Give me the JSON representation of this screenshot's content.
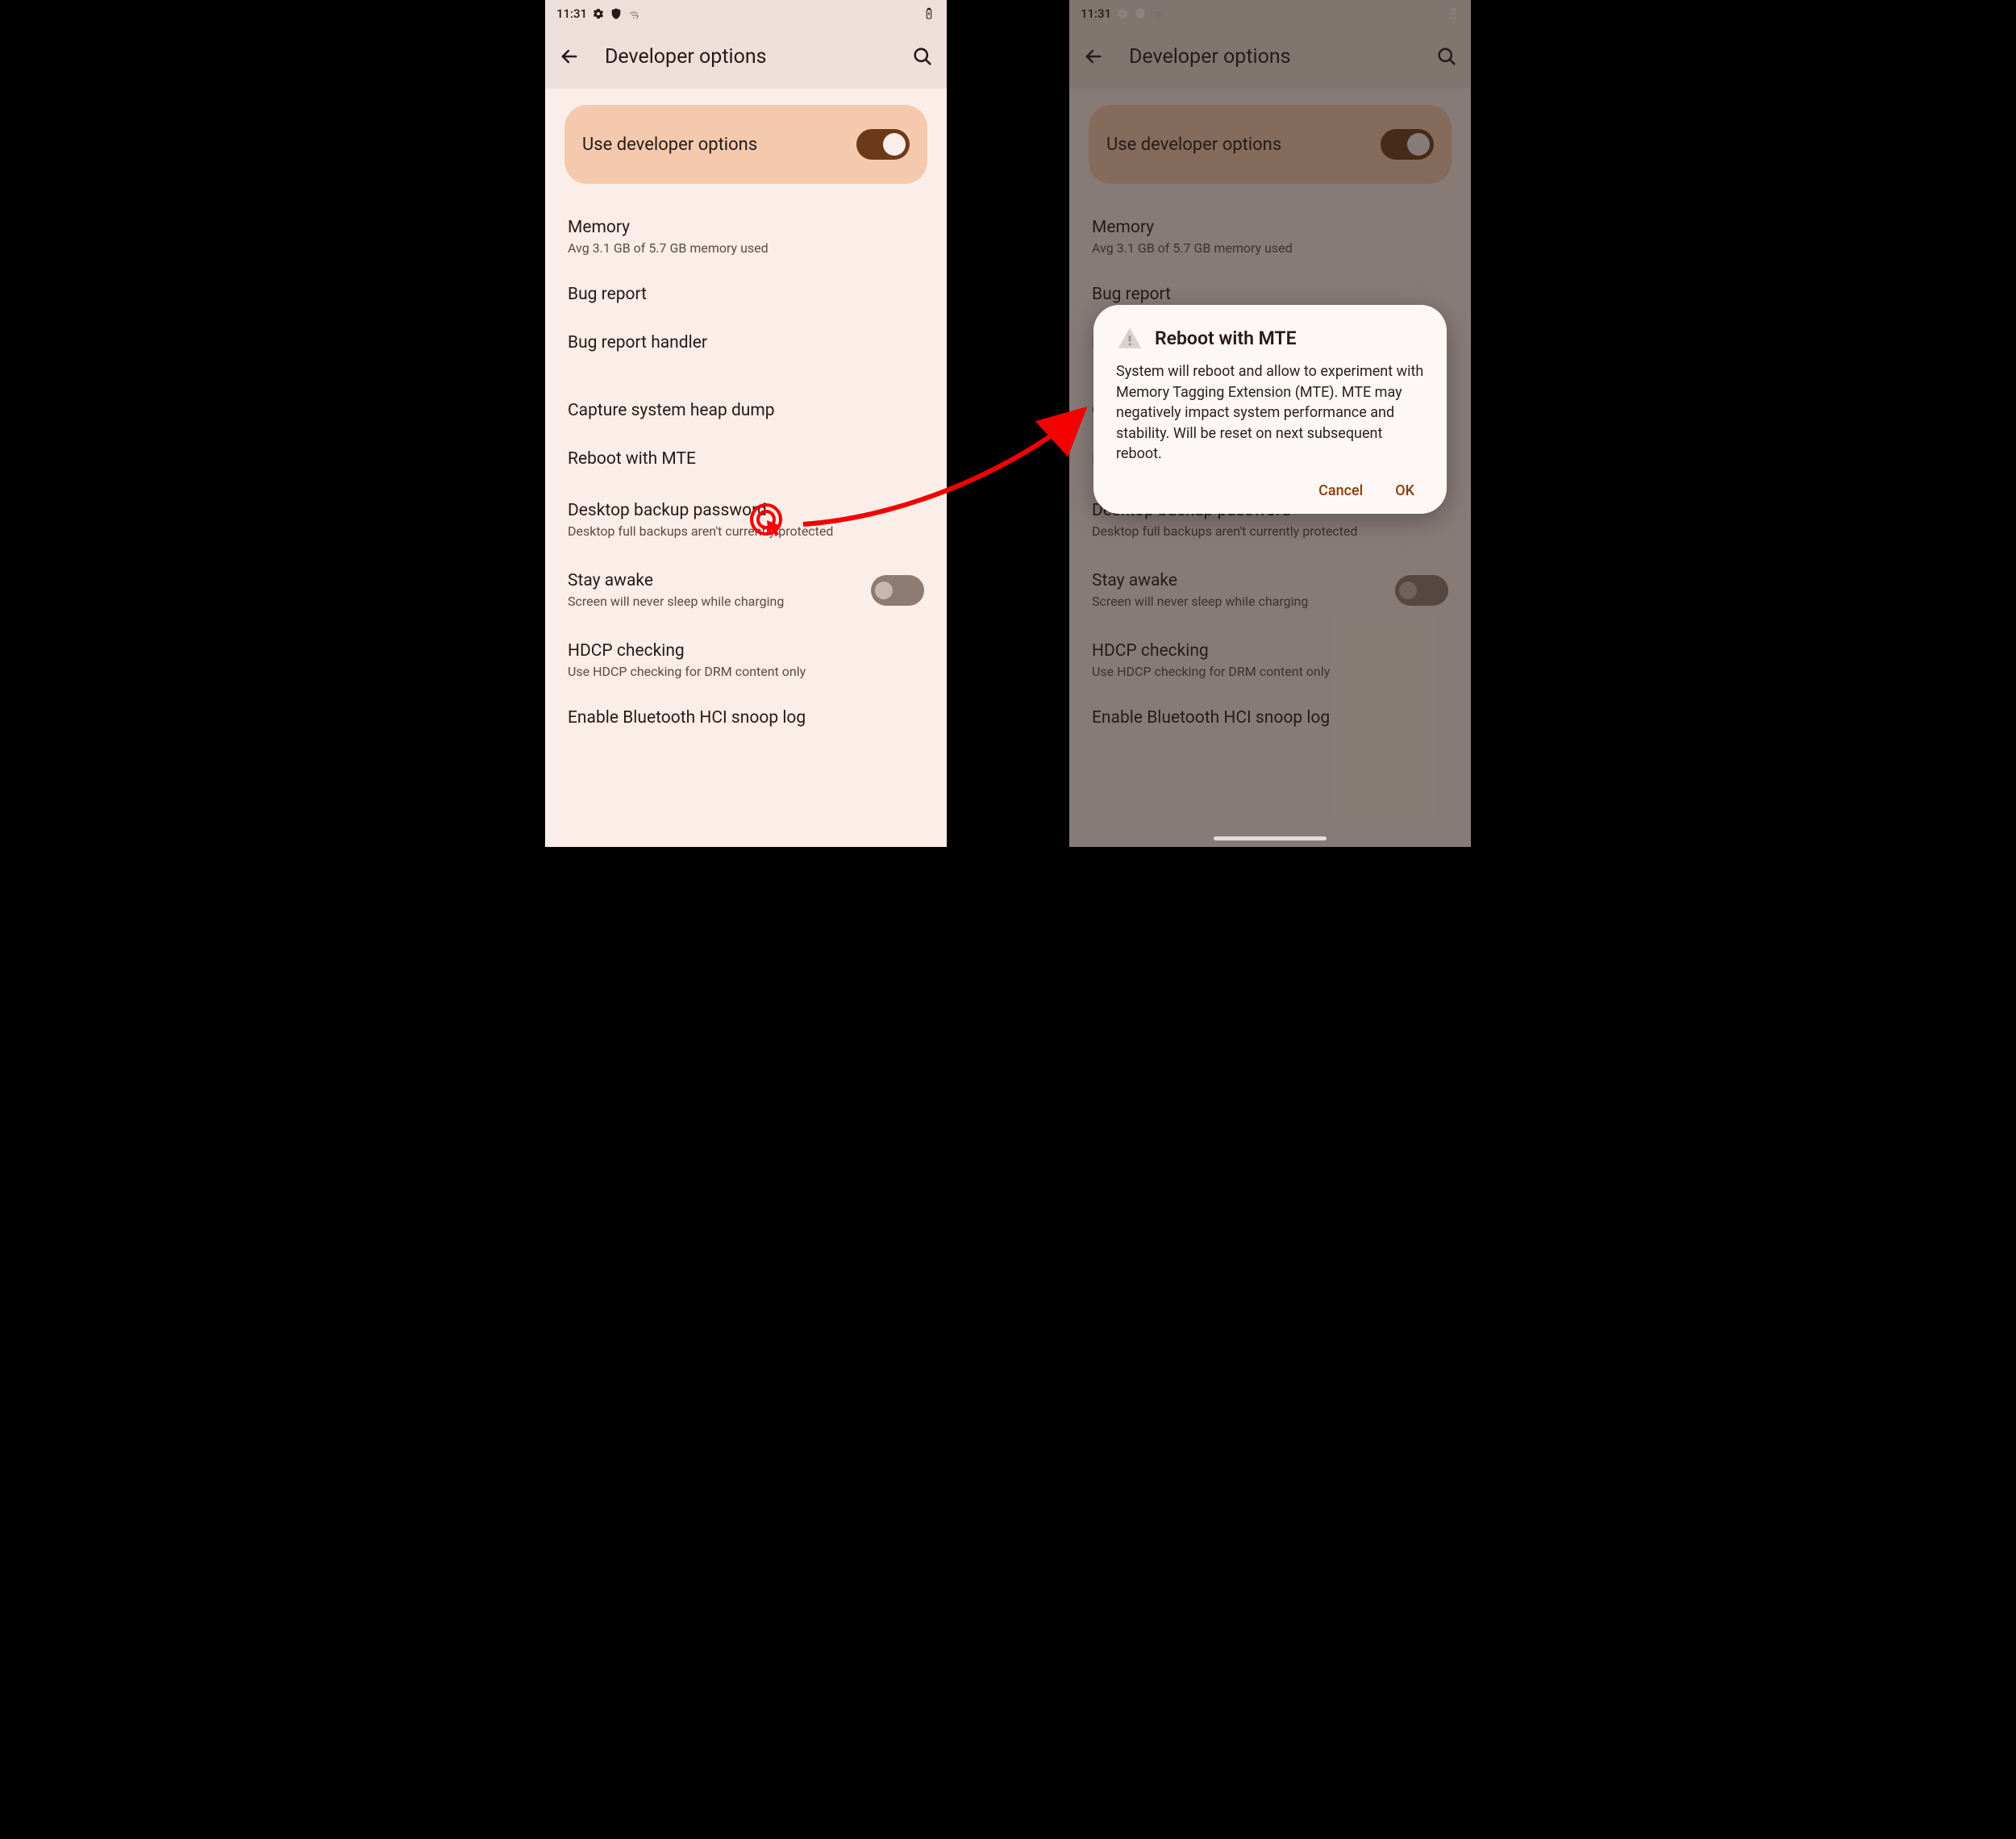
{
  "statusbar": {
    "time": "11:31"
  },
  "header": {
    "title": "Developer options"
  },
  "master": {
    "label": "Use developer options"
  },
  "rows": {
    "memory": {
      "title": "Memory",
      "sub": "Avg 3.1 GB of 5.7 GB memory used"
    },
    "bugreport": {
      "title": "Bug report"
    },
    "bugreporthandler": {
      "title": "Bug report handler"
    },
    "heapdump": {
      "title": "Capture system heap dump"
    },
    "rebootmte": {
      "title": "Reboot with MTE"
    },
    "desktopbackup": {
      "title": "Desktop backup password",
      "sub": "Desktop full backups aren't currently protected"
    },
    "stayawake": {
      "title": "Stay awake",
      "sub": "Screen will never sleep while charging"
    },
    "hdcp": {
      "title": "HDCP checking",
      "sub": "Use HDCP checking for DRM content only"
    },
    "btsnoop": {
      "title": "Enable Bluetooth HCI snoop log"
    }
  },
  "dialog": {
    "title": "Reboot with MTE",
    "body": "System will reboot and allow to experiment with Memory Tagging Extension (MTE). MTE may negatively impact system performance and stability. Will be reset on next subsequent reboot.",
    "cancel": "Cancel",
    "ok": "OK"
  }
}
